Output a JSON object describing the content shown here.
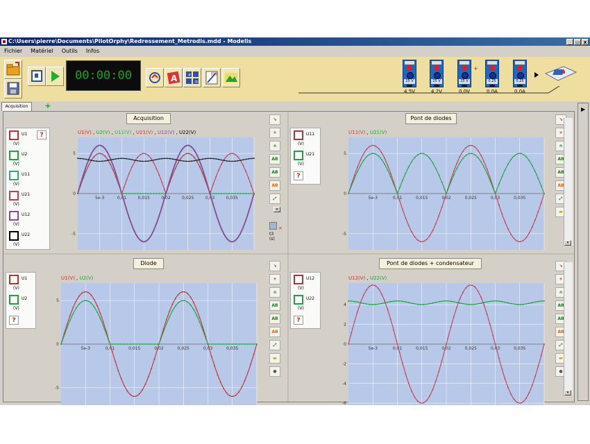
{
  "window": {
    "title": "C:\\Users\\pierre\\Documents\\PilotOrphy\\Redressement_Metrodis.mdd - Modelis",
    "buttons": [
      "_",
      "▭",
      "x"
    ]
  },
  "menu": [
    "Fichier",
    "Matériel",
    "Outils",
    "Infos"
  ],
  "toolbar": {
    "clock": "00:00:00",
    "meters": [
      {
        "range": "25 V",
        "value": "4,5V"
      },
      {
        "range": "25 V",
        "value": "4,2V"
      },
      {
        "range": "25 V",
        "value": "0,0V"
      },
      {
        "range": "0,25 A",
        "value": "0,0A"
      },
      {
        "range": "0,25 A",
        "value": "0,0A"
      }
    ]
  },
  "tabs": {
    "active": "Acquisition",
    "add": "+"
  },
  "colors": {
    "u1": "#c03030",
    "u2": "#20a040",
    "u11": "#35a878",
    "u21": "#c04050",
    "u12": "#8a4a9a",
    "u22": "#000000",
    "plot_bg": "#b7c8e8"
  },
  "panels": {
    "acquisition": {
      "title": "Acquisition",
      "header": [
        {
          "t": "U1(V)",
          "c": "#c03030"
        },
        {
          "t": " , ",
          "c": "#000000"
        },
        {
          "t": "U2(V)",
          "c": "#20a040"
        },
        {
          "t": " , ",
          "c": "#000000"
        },
        {
          "t": "U11(V)",
          "c": "#35a878"
        },
        {
          "t": " , ",
          "c": "#000000"
        },
        {
          "t": "U21(V)",
          "c": "#c04050"
        },
        {
          "t": " , ",
          "c": "#000000"
        },
        {
          "t": "U12(V)",
          "c": "#8a4a9a"
        },
        {
          "t": " , ",
          "c": "#000000"
        },
        {
          "t": "U22(V)",
          "c": "#000000"
        }
      ],
      "legend": [
        {
          "name": "U1",
          "unit": "(V)",
          "color": "#c03030"
        },
        {
          "name": "U2",
          "unit": "(V)",
          "color": "#20a040"
        },
        {
          "name": "U11",
          "unit": "(V)",
          "color": "#35a878"
        },
        {
          "name": "U21",
          "unit": "(V)",
          "color": "#c04050"
        },
        {
          "name": "U12",
          "unit": "(V)",
          "color": "#8a4a9a"
        },
        {
          "name": "U22",
          "unit": "(V)",
          "color": "#000000"
        }
      ],
      "xticks": [
        "5e-3",
        "0,01",
        "0,015",
        "0,02",
        "0,025",
        "0,03",
        "0,035"
      ],
      "yticks": [
        "5",
        "0",
        "-5"
      ],
      "cursor_label": "t3",
      "cursor_unit": "(s)"
    },
    "pont": {
      "title": "Pont de diodes",
      "header": [
        {
          "t": "U11(V)",
          "c": "#c04050"
        },
        {
          "t": " , ",
          "c": "#000000"
        },
        {
          "t": "U21(V)",
          "c": "#20a040"
        }
      ],
      "legend": [
        {
          "name": "U11",
          "unit": "(V)",
          "color": "#c03030"
        },
        {
          "name": "U21",
          "unit": "(V)",
          "color": "#20a040"
        }
      ],
      "xticks": [
        "5e-3",
        "0,01",
        "0,015",
        "0,02",
        "0,025",
        "0,03",
        "0,035"
      ],
      "yticks": [
        "5",
        "0",
        "-5"
      ]
    },
    "diode": {
      "title": "Diode",
      "header": [
        {
          "t": "U1(V)",
          "c": "#c03030"
        },
        {
          "t": " , ",
          "c": "#000000"
        },
        {
          "t": "U2(V)",
          "c": "#20a040"
        }
      ],
      "legend": [
        {
          "name": "U1",
          "unit": "(V)",
          "color": "#c03030"
        },
        {
          "name": "U2",
          "unit": "(V)",
          "color": "#20a040"
        }
      ],
      "xticks": [
        "5e-3",
        "0,01",
        "0,015",
        "0,02",
        "0,025",
        "0,03",
        "0,035"
      ],
      "yticks": [
        "5",
        "0",
        "-5"
      ]
    },
    "condensateur": {
      "title": "Pont de diodes + condensateur",
      "header": [
        {
          "t": "U12(V)",
          "c": "#c03030"
        },
        {
          "t": " , ",
          "c": "#000000"
        },
        {
          "t": "U22(V)",
          "c": "#20a040"
        }
      ],
      "legend": [
        {
          "name": "U12",
          "unit": "(V)",
          "color": "#c03030"
        },
        {
          "name": "U22",
          "unit": "(V)",
          "color": "#20a040"
        }
      ],
      "xticks": [
        "5e-3",
        "0,01",
        "0,015",
        "0,02",
        "0,025",
        "0,03",
        "0,035"
      ],
      "yticks": [
        "4",
        "2",
        "0",
        "-2",
        "-4",
        "-6"
      ]
    }
  },
  "chart_data": [
    {
      "type": "line",
      "title": "Acquisition",
      "xlim": [
        0,
        0.04
      ],
      "ylim": [
        -7,
        7
      ],
      "series": [
        {
          "name": "U1(V)",
          "shape": "sine",
          "amplitude": 6,
          "period": 0.02
        },
        {
          "name": "U2(V)",
          "shape": "half-wave",
          "amplitude": 5,
          "period": 0.02
        },
        {
          "name": "U11(V)",
          "shape": "sine",
          "amplitude": 6,
          "period": 0.02
        },
        {
          "name": "U21(V)",
          "shape": "full-wave",
          "amplitude": 5,
          "period": 0.02
        },
        {
          "name": "U12(V)",
          "shape": "sine",
          "amplitude": 6,
          "period": 0.02
        },
        {
          "name": "U22(V)",
          "shape": "filtered",
          "level": 4.2,
          "period": 0.02
        }
      ]
    },
    {
      "type": "line",
      "title": "Pont de diodes",
      "xlim": [
        0,
        0.04
      ],
      "ylim": [
        -7,
        7
      ],
      "series": [
        {
          "name": "U11(V)",
          "shape": "sine",
          "amplitude": 6,
          "period": 0.02
        },
        {
          "name": "U21(V)",
          "shape": "full-wave",
          "amplitude": 5,
          "period": 0.02
        }
      ]
    },
    {
      "type": "line",
      "title": "Diode",
      "xlim": [
        0,
        0.04
      ],
      "ylim": [
        -7,
        7
      ],
      "series": [
        {
          "name": "U1(V)",
          "shape": "sine",
          "amplitude": 6,
          "period": 0.02
        },
        {
          "name": "U2(V)",
          "shape": "half-wave",
          "amplitude": 5,
          "period": 0.02
        }
      ]
    },
    {
      "type": "line",
      "title": "Pont de diodes + condensateur",
      "xlim": [
        0,
        0.04
      ],
      "ylim": [
        -6.2,
        6.2
      ],
      "series": [
        {
          "name": "U12(V)",
          "shape": "sine",
          "amplitude": 6,
          "period": 0.02
        },
        {
          "name": "U22(V)",
          "shape": "filtered",
          "level": 4.2,
          "period": 0.02
        }
      ]
    }
  ]
}
